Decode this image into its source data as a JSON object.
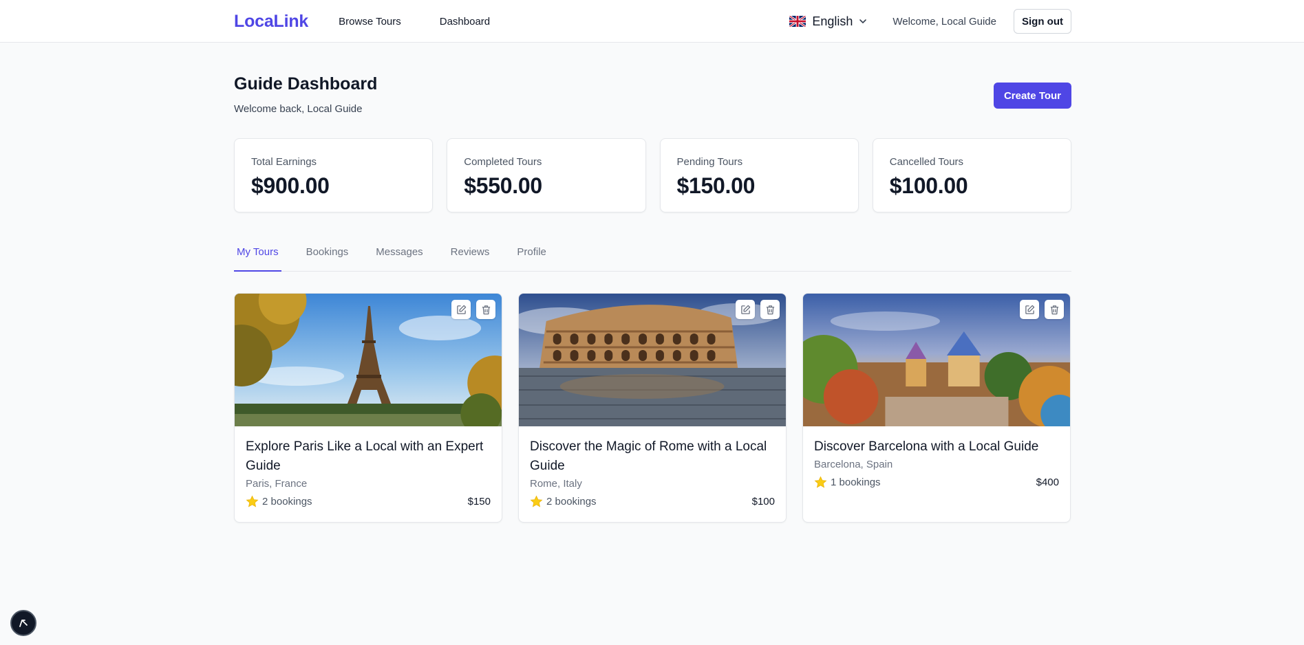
{
  "header": {
    "logo": "LocaLink",
    "nav": [
      "Browse Tours",
      "Dashboard"
    ],
    "language": "English",
    "welcome": "Welcome, Local Guide",
    "sign_out": "Sign out"
  },
  "page": {
    "title": "Guide Dashboard",
    "subtitle": "Welcome back, Local Guide",
    "create_button": "Create Tour"
  },
  "stats": [
    {
      "label": "Total Earnings",
      "value": "$900.00"
    },
    {
      "label": "Completed Tours",
      "value": "$550.00"
    },
    {
      "label": "Pending Tours",
      "value": "$150.00"
    },
    {
      "label": "Cancelled Tours",
      "value": "$100.00"
    }
  ],
  "tabs": [
    "My Tours",
    "Bookings",
    "Messages",
    "Reviews",
    "Profile"
  ],
  "active_tab": "My Tours",
  "tours": [
    {
      "title": "Explore Paris Like a Local with an Expert Guide",
      "location": "Paris, France",
      "bookings": "2 bookings",
      "price": "$150",
      "image": "eiffel-tower-photo"
    },
    {
      "title": "Discover the Magic of Rome with a Local Guide",
      "location": "Rome, Italy",
      "bookings": "2 bookings",
      "price": "$100",
      "image": "colosseum-photo"
    },
    {
      "title": "Discover Barcelona with a Local Guide",
      "location": "Barcelona, Spain",
      "bookings": "1 bookings",
      "price": "$400",
      "image": "park-guell-photo"
    }
  ],
  "colors": {
    "accent": "#4f46e5",
    "star": "#facc15"
  },
  "icons": {
    "language": "uk-flag-icon",
    "edit": "edit-icon",
    "delete": "trash-icon",
    "rating": "star-icon",
    "corner": "cursor-icon"
  }
}
